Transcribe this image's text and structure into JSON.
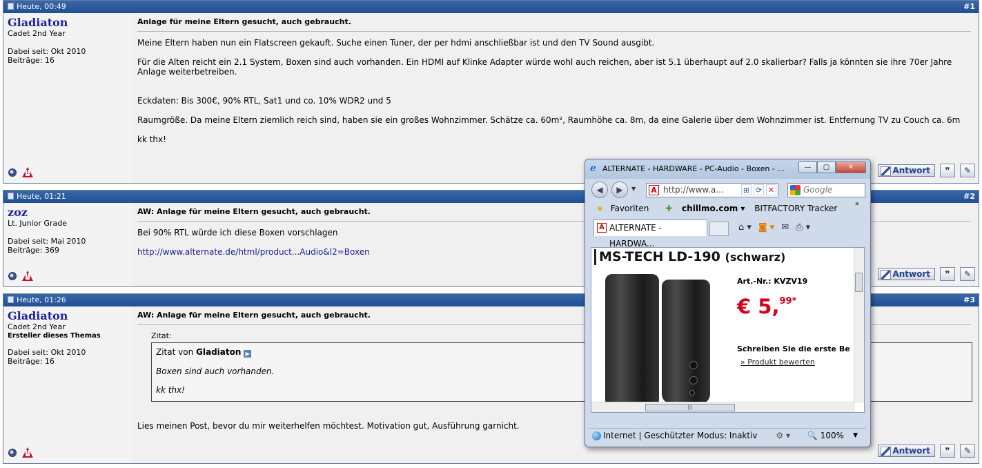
{
  "posts": [
    {
      "date": "Heute, 00:49",
      "number": "#1",
      "user": "Gladiaton",
      "rank": "Cadet 2nd Year",
      "joined": "Dabei seit: Okt 2010",
      "posts": "Beiträge: 16",
      "title": "Anlage für meine Eltern gesucht, auch gebraucht.",
      "paragraphs": [
        "Meine Eltern haben nun ein Flatscreen gekauft. Suche einen Tuner, der per hdmi anschließbar ist und den TV Sound ausgibt.",
        "Für die Alten reicht ein 2.1 System, Boxen sind auch vorhanden. Ein HDMI auf Klinke Adapter würde wohl auch reichen, aber ist 5.1 überhaupt auf 2.0 skalierbar? Falls ja könnten sie ihre 70er Jahre Anlage weiterbetreiben.",
        "Eckdaten: Bis 300€, 90% RTL, Sat1 und co. 10% WDR2 und 5",
        "Raumgröße. Da meine Eltern ziemlich reich sind, haben sie ein großes Wohnzimmer. Schätze ca. 60m², Raumhöhe ca. 8m, da eine Galerie über dem Wohnzimmer ist. Entfernung TV zu Couch ca. 6m",
        "kk thx!"
      ],
      "reply_label": "Antwort"
    },
    {
      "date": "Heute, 01:21",
      "number": "#2",
      "user": "zoz",
      "rank": "Lt. Junior Grade",
      "joined": "Dabei seit: Mai 2010",
      "posts": "Beiträge: 369",
      "title": "AW: Anlage für meine Eltern gesucht, auch gebraucht.",
      "paragraphs": [
        "Bei 90% RTL würde ich diese Boxen vorschlagen"
      ],
      "link": "http://www.alternate.de/html/product...Audio&l2=Boxen",
      "reply_label": "Antwort"
    },
    {
      "date": "Heute, 01:26",
      "number": "#3",
      "user": "Gladiaton",
      "rank": "Cadet 2nd Year",
      "op_label": "Ersteller dieses Themas",
      "joined": "Dabei seit: Okt 2010",
      "posts": "Beiträge: 16",
      "title": "AW: Anlage für meine Eltern gesucht, auch gebraucht.",
      "quote": {
        "label": "Zitat:",
        "from_prefix": "Zitat von",
        "from_user": "Gladiaton",
        "lines": [
          "Boxen sind auch vorhanden.",
          "kk thx!"
        ]
      },
      "paragraphs": [
        "Lies meinen Post, bevor du mir weiterhelfen möchtest. Motivation gut, Ausführung garnicht."
      ],
      "reply_label": "Antwort"
    }
  ],
  "icons": {
    "multiquote": "❞",
    "edit": "✎",
    "report": "!"
  },
  "browser": {
    "title": "ALTERNATE - HARDWARE - PC-Audio - Boxen - ...",
    "address": "http://www.a...",
    "search_placeholder": "Google",
    "favorites": [
      "Favoriten",
      "chillmo.com ▾",
      "BITFACTORY Tracker"
    ],
    "tab_label": "ALTERNATE - HARDWA...",
    "product": {
      "name": "MS-TECH LD-190",
      "variant": "(schwarz)",
      "art_nr": "Art.-Nr.: KVZV19",
      "price_main": "€ 5,",
      "price_cents": "99*",
      "review": "Schreiben Sie die erste Be",
      "rate": "» Produkt bewerten"
    },
    "status_text": "Internet | Geschützter Modus: Inaktiv",
    "zoom": "100%",
    "accent_red": "#d6001c"
  }
}
